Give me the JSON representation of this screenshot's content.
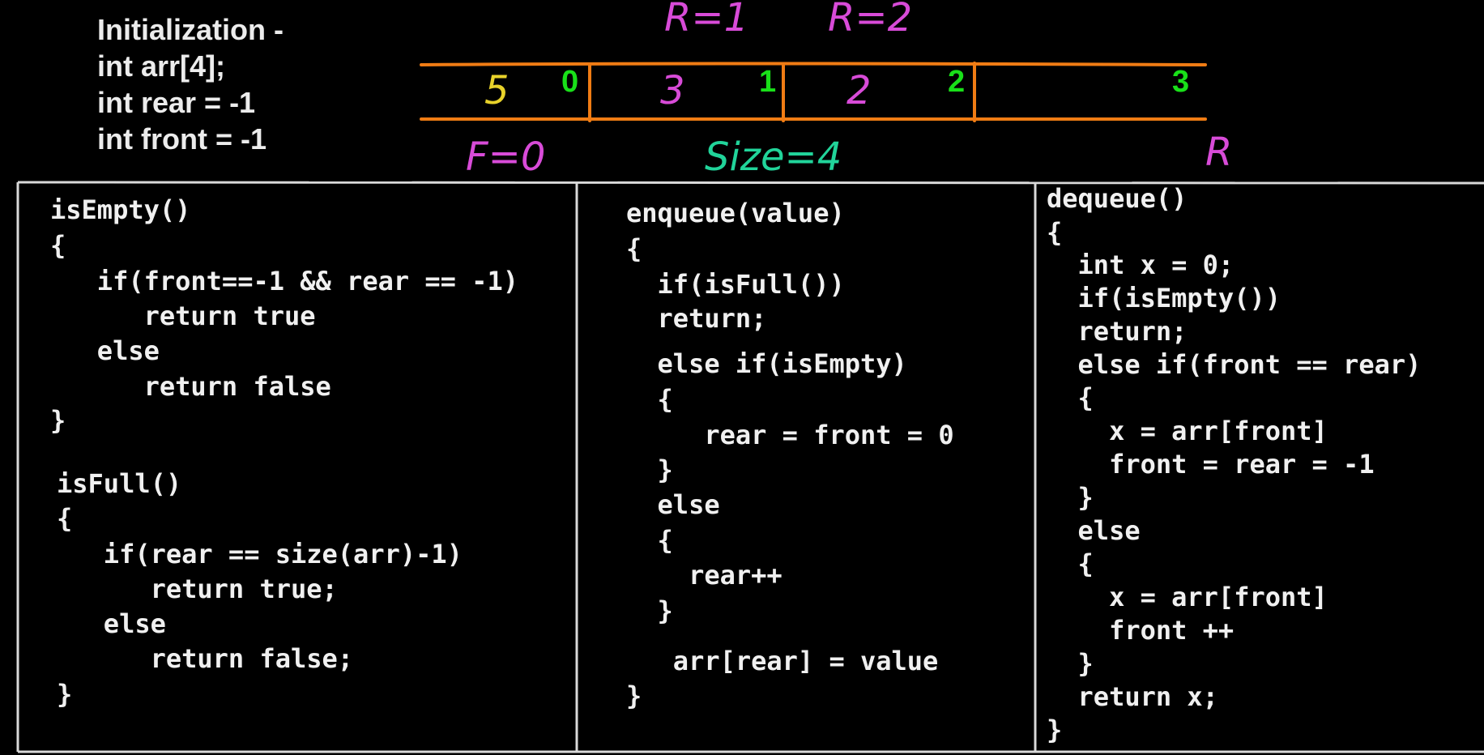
{
  "colors": {
    "background": "#000000",
    "code_text": "#f0f0f0",
    "orange": "#f07c14",
    "magenta": "#d84bd8",
    "yellow": "#e8d22a",
    "green_index": "#19e019",
    "green_size": "#21d49a"
  },
  "initialization": [
    "Initialization -",
    "int arr[4];",
    "int rear = -1",
    "int front = -1"
  ],
  "annotations": {
    "r1": "R=1",
    "r2": "R=2",
    "f0": "F=0",
    "size": "Size=4",
    "r_end": "R"
  },
  "array": {
    "cells": [
      "5",
      "3",
      "2",
      ""
    ],
    "indices": [
      "0",
      "1",
      "2",
      "3"
    ]
  },
  "panels": {
    "is_empty": [
      "isEmpty()",
      "{",
      "   if(front==-1 && rear == -1)",
      "      return true",
      "   else",
      "      return false",
      "}"
    ],
    "is_full": [
      "isFull()",
      "{",
      "   if(rear == size(arr)-1)",
      "      return true;",
      "   else",
      "      return false;",
      "}"
    ],
    "enqueue": [
      "enqueue(value)",
      "{",
      "  if(isFull())",
      "  return;",
      "  else if(isEmpty)",
      "  {",
      "     rear = front = 0",
      "  }",
      "  else",
      "  {",
      "    rear++",
      "  }",
      "   arr[rear] = value",
      "}"
    ],
    "dequeue": [
      "dequeue()",
      "{",
      "  int x = 0;",
      "  if(isEmpty())",
      "  return;",
      "  else if(front == rear)",
      "  {",
      "    x = arr[front]",
      "    front = rear = -1",
      "  }",
      "  else",
      "  {",
      "    x = arr[front]",
      "    front ++",
      "  }",
      "  return x;",
      "}"
    ]
  }
}
